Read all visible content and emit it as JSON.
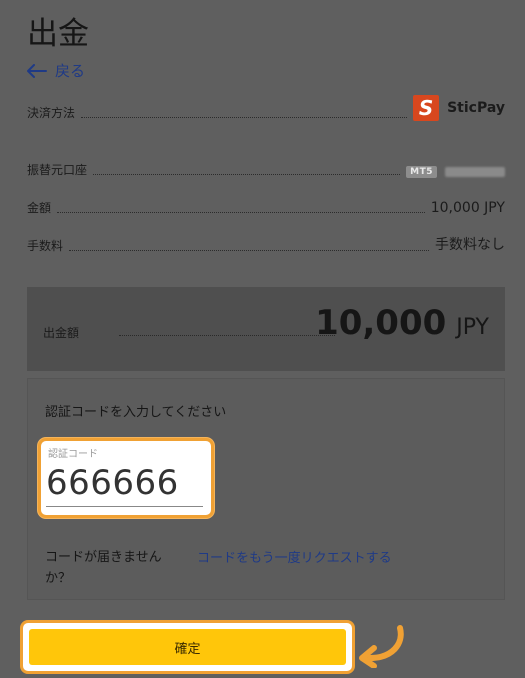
{
  "page": {
    "title": "出金"
  },
  "back": {
    "label": "戻る"
  },
  "rows": {
    "payment_method": {
      "label": "決済方法",
      "value": "SticPay"
    },
    "transfer_account": {
      "label": "振替元口座",
      "badge": "MT5"
    },
    "amount": {
      "label": "金額",
      "value": "10,000 JPY"
    },
    "fee": {
      "label": "手数料",
      "value": "手数料なし"
    }
  },
  "withdrawal": {
    "label": "出金額",
    "amount": "10,000",
    "currency": "JPY"
  },
  "verification": {
    "prompt": "認証コードを入力してください",
    "field_label": "認証コード",
    "field_value": "666666",
    "no_code_text": "コードが届きませんか？",
    "request_link": "コードをもう一度リクエストする"
  },
  "confirm": {
    "label": "確定"
  },
  "colors": {
    "highlight": "#f0a134",
    "button": "#ffc60a",
    "link": "#1f3a86",
    "logo": "#d8471e"
  }
}
